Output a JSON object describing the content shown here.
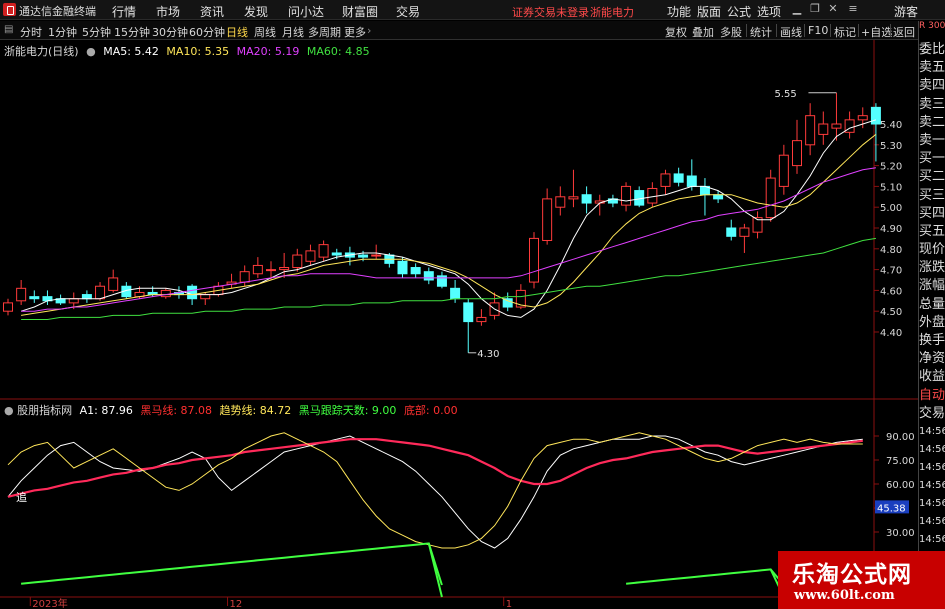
{
  "titlebar": {
    "app_name": "通达信金融终端",
    "menu": [
      "行情",
      "市场",
      "资讯",
      "发现",
      "问小达",
      "财富圈",
      "交易"
    ],
    "warning": "证券交易未登录",
    "stock_name": "浙能电力",
    "right_menu": [
      "功能",
      "版面",
      "公式",
      "选项"
    ],
    "guest": "游客"
  },
  "toolbar": {
    "left": "主图",
    "periods": [
      "分时",
      "1分钟",
      "5分钟",
      "15分钟",
      "30分钟",
      "60分钟",
      "日线",
      "周线",
      "月线",
      "多周期",
      "更多"
    ],
    "active_period": "日线",
    "right": [
      "复权",
      "叠加",
      "多股",
      "统计",
      "画线",
      "F10",
      "标记",
      "+自选",
      "返回"
    ]
  },
  "main_legend": {
    "title": "浙能电力(日线)",
    "ma": [
      {
        "label": "MA5: 5.42",
        "color": "#ffffff"
      },
      {
        "label": "MA10: 5.35",
        "color": "#ffe65a"
      },
      {
        "label": "MA20: 5.19",
        "color": "#e040ff"
      },
      {
        "label": "MA60: 4.85",
        "color": "#40e040"
      }
    ]
  },
  "sub_legend": {
    "title": "股朋指标网",
    "items": [
      {
        "label": "A1: 87.96",
        "color": "#ffffff"
      },
      {
        "label": "黑马线: 87.08",
        "color": "#ff3030"
      },
      {
        "label": "趋势线: 84.72",
        "color": "#ffe65a"
      },
      {
        "label": "黑马跟踪天数: 9.00",
        "color": "#40ff40"
      },
      {
        "label": "底部: 0.00",
        "color": "#ff3030"
      }
    ],
    "signal": "追"
  },
  "price_axis": [
    "5.40",
    "5.30",
    "5.20",
    "5.10",
    "5.00",
    "4.90",
    "4.80",
    "4.70",
    "4.60",
    "4.50",
    "4.40"
  ],
  "sub_axis": [
    "90.00",
    "75.00",
    "60.00",
    "45.38",
    "30.00"
  ],
  "highlight_value": "45.38",
  "annotations": {
    "high": "5.55",
    "low": "4.30"
  },
  "date_axis": [
    "2023年",
    "12",
    "1"
  ],
  "side_panel": {
    "top_small": "R 300",
    "items": [
      "委比",
      "卖五",
      "卖四",
      "卖三",
      "卖二",
      "卖一",
      "买一",
      "买二",
      "买三",
      "买四",
      "买五",
      "现价",
      "涨跌",
      "涨幅",
      "总量",
      "外盘",
      "换手",
      "净资",
      "收益"
    ],
    "lower": [
      "自动",
      "交易"
    ],
    "times": [
      "14:56",
      "14:56",
      "14:56",
      "14:56",
      "14:56",
      "14:56",
      "14:56",
      "14:56",
      "14:56"
    ]
  },
  "watermark": {
    "cn": "乐淘公式网",
    "en": "www.60lt.com"
  },
  "colors": {
    "up": "#ff3b3b",
    "down": "#54ffff",
    "ma5": "#ffffff",
    "ma10": "#ffe65a",
    "ma20": "#e040ff",
    "ma60": "#40e040",
    "heima": "#ff2a5a",
    "trend": "#ffe65a",
    "track": "#40ff40"
  },
  "chart_data": [
    {
      "type": "candlestick",
      "title": "浙能电力(日线)",
      "ylim": [
        4.3,
        5.6
      ],
      "y_ticks": [
        4.4,
        4.5,
        4.6,
        4.7,
        4.8,
        4.9,
        5.0,
        5.1,
        5.2,
        5.3,
        5.4
      ],
      "candles": [
        {
          "o": 4.5,
          "h": 4.56,
          "l": 4.48,
          "c": 4.54
        },
        {
          "o": 4.55,
          "h": 4.65,
          "l": 4.53,
          "c": 4.61
        },
        {
          "o": 4.57,
          "h": 4.6,
          "l": 4.54,
          "c": 4.56
        },
        {
          "o": 4.57,
          "h": 4.6,
          "l": 4.53,
          "c": 4.55
        },
        {
          "o": 4.56,
          "h": 4.58,
          "l": 4.53,
          "c": 4.54
        },
        {
          "o": 4.54,
          "h": 4.59,
          "l": 4.51,
          "c": 4.56
        },
        {
          "o": 4.58,
          "h": 4.6,
          "l": 4.54,
          "c": 4.56
        },
        {
          "o": 4.56,
          "h": 4.64,
          "l": 4.55,
          "c": 4.62
        },
        {
          "o": 4.6,
          "h": 4.7,
          "l": 4.59,
          "c": 4.66
        },
        {
          "o": 4.62,
          "h": 4.64,
          "l": 4.56,
          "c": 4.57
        },
        {
          "o": 4.57,
          "h": 4.62,
          "l": 4.56,
          "c": 4.59
        },
        {
          "o": 4.59,
          "h": 4.62,
          "l": 4.57,
          "c": 4.58
        },
        {
          "o": 4.57,
          "h": 4.61,
          "l": 4.56,
          "c": 4.6
        },
        {
          "o": 4.59,
          "h": 4.62,
          "l": 4.56,
          "c": 4.58
        },
        {
          "o": 4.62,
          "h": 4.63,
          "l": 4.53,
          "c": 4.56
        },
        {
          "o": 4.56,
          "h": 4.59,
          "l": 4.53,
          "c": 4.58
        },
        {
          "o": 4.58,
          "h": 4.64,
          "l": 4.57,
          "c": 4.62
        },
        {
          "o": 4.63,
          "h": 4.68,
          "l": 4.61,
          "c": 4.64
        },
        {
          "o": 4.64,
          "h": 4.72,
          "l": 4.62,
          "c": 4.69
        },
        {
          "o": 4.68,
          "h": 4.76,
          "l": 4.66,
          "c": 4.72
        },
        {
          "o": 4.7,
          "h": 4.74,
          "l": 4.65,
          "c": 4.7
        },
        {
          "o": 4.7,
          "h": 4.78,
          "l": 4.66,
          "c": 4.71
        },
        {
          "o": 4.71,
          "h": 4.8,
          "l": 4.69,
          "c": 4.77
        },
        {
          "o": 4.74,
          "h": 4.82,
          "l": 4.72,
          "c": 4.79
        },
        {
          "o": 4.76,
          "h": 4.84,
          "l": 4.74,
          "c": 4.82
        },
        {
          "o": 4.78,
          "h": 4.8,
          "l": 4.75,
          "c": 4.77
        },
        {
          "o": 4.78,
          "h": 4.81,
          "l": 4.72,
          "c": 4.76
        },
        {
          "o": 4.77,
          "h": 4.79,
          "l": 4.74,
          "c": 4.76
        },
        {
          "o": 4.77,
          "h": 4.82,
          "l": 4.75,
          "c": 4.77
        },
        {
          "o": 4.77,
          "h": 4.78,
          "l": 4.71,
          "c": 4.73
        },
        {
          "o": 4.74,
          "h": 4.76,
          "l": 4.66,
          "c": 4.68
        },
        {
          "o": 4.71,
          "h": 4.73,
          "l": 4.66,
          "c": 4.68
        },
        {
          "o": 4.69,
          "h": 4.71,
          "l": 4.63,
          "c": 4.65
        },
        {
          "o": 4.67,
          "h": 4.69,
          "l": 4.61,
          "c": 4.62
        },
        {
          "o": 4.61,
          "h": 4.65,
          "l": 4.54,
          "c": 4.56
        },
        {
          "o": 4.54,
          "h": 4.56,
          "l": 4.3,
          "c": 4.45
        },
        {
          "o": 4.45,
          "h": 4.51,
          "l": 4.43,
          "c": 4.47
        },
        {
          "o": 4.48,
          "h": 4.59,
          "l": 4.46,
          "c": 4.54
        },
        {
          "o": 4.56,
          "h": 4.59,
          "l": 4.5,
          "c": 4.52
        },
        {
          "o": 4.52,
          "h": 4.63,
          "l": 4.51,
          "c": 4.6
        },
        {
          "o": 4.64,
          "h": 4.88,
          "l": 4.61,
          "c": 4.85
        },
        {
          "o": 4.84,
          "h": 5.09,
          "l": 4.82,
          "c": 5.04
        },
        {
          "o": 5.0,
          "h": 5.1,
          "l": 4.96,
          "c": 5.05
        },
        {
          "o": 5.04,
          "h": 5.18,
          "l": 5.0,
          "c": 5.05
        },
        {
          "o": 5.06,
          "h": 5.1,
          "l": 4.97,
          "c": 5.02
        },
        {
          "o": 5.02,
          "h": 5.06,
          "l": 4.96,
          "c": 5.03
        },
        {
          "o": 5.04,
          "h": 5.06,
          "l": 5.0,
          "c": 5.02
        },
        {
          "o": 5.01,
          "h": 5.12,
          "l": 4.98,
          "c": 5.1
        },
        {
          "o": 5.08,
          "h": 5.1,
          "l": 5.0,
          "c": 5.01
        },
        {
          "o": 5.02,
          "h": 5.12,
          "l": 5.0,
          "c": 5.09
        },
        {
          "o": 5.1,
          "h": 5.18,
          "l": 5.06,
          "c": 5.16
        },
        {
          "o": 5.16,
          "h": 5.19,
          "l": 5.1,
          "c": 5.12
        },
        {
          "o": 5.15,
          "h": 5.23,
          "l": 5.08,
          "c": 5.1
        },
        {
          "o": 5.1,
          "h": 5.14,
          "l": 4.96,
          "c": 5.06
        },
        {
          "o": 5.06,
          "h": 5.08,
          "l": 5.02,
          "c": 5.04
        },
        {
          "o": 4.9,
          "h": 4.94,
          "l": 4.84,
          "c": 4.86
        },
        {
          "o": 4.86,
          "h": 4.92,
          "l": 4.78,
          "c": 4.9
        },
        {
          "o": 4.88,
          "h": 4.98,
          "l": 4.85,
          "c": 4.95
        },
        {
          "o": 4.95,
          "h": 5.18,
          "l": 4.93,
          "c": 5.14
        },
        {
          "o": 5.1,
          "h": 5.3,
          "l": 5.06,
          "c": 5.25
        },
        {
          "o": 5.2,
          "h": 5.42,
          "l": 5.16,
          "c": 5.32
        },
        {
          "o": 5.3,
          "h": 5.5,
          "l": 5.25,
          "c": 5.44
        },
        {
          "o": 5.35,
          "h": 5.46,
          "l": 5.3,
          "c": 5.4
        },
        {
          "o": 5.38,
          "h": 5.55,
          "l": 5.32,
          "c": 5.4
        },
        {
          "o": 5.36,
          "h": 5.46,
          "l": 5.33,
          "c": 5.42
        },
        {
          "o": 5.42,
          "h": 5.48,
          "l": 5.38,
          "c": 5.44
        },
        {
          "o": 5.48,
          "h": 5.5,
          "l": 5.22,
          "c": 5.4
        }
      ],
      "ma_series": [
        {
          "name": "MA5",
          "values": [
            4.5,
            4.52,
            4.55,
            4.56,
            4.56,
            4.56,
            4.56,
            4.58,
            4.6,
            4.61,
            4.61,
            4.61,
            4.6,
            4.58,
            4.58,
            4.58,
            4.59,
            4.61,
            4.63,
            4.66,
            4.69,
            4.7,
            4.72,
            4.74,
            4.76,
            4.77,
            4.78,
            4.78,
            4.77,
            4.76,
            4.74,
            4.72,
            4.7,
            4.68,
            4.63,
            4.56,
            4.51,
            4.48,
            4.47,
            4.51,
            4.6,
            4.72,
            4.85,
            4.96,
            5.02,
            5.04,
            5.03,
            5.04,
            5.05,
            5.06,
            5.08,
            5.1,
            5.1,
            5.08,
            5.04,
            4.98,
            4.94,
            4.94,
            4.98,
            5.06,
            5.15,
            5.26,
            5.34,
            5.38,
            5.4,
            5.42
          ]
        },
        {
          "name": "MA10",
          "values": [
            4.48,
            4.49,
            4.5,
            4.51,
            4.52,
            4.53,
            4.54,
            4.55,
            4.56,
            4.57,
            4.58,
            4.58,
            4.58,
            4.58,
            4.59,
            4.6,
            4.61,
            4.62,
            4.63,
            4.65,
            4.67,
            4.68,
            4.7,
            4.72,
            4.73,
            4.74,
            4.75,
            4.75,
            4.75,
            4.75,
            4.74,
            4.73,
            4.71,
            4.69,
            4.66,
            4.62,
            4.58,
            4.55,
            4.53,
            4.52,
            4.54,
            4.58,
            4.64,
            4.71,
            4.78,
            4.86,
            4.92,
            4.97,
            5.0,
            5.02,
            5.04,
            5.05,
            5.06,
            5.06,
            5.06,
            5.04,
            5.02,
            5.01,
            5.0,
            5.02,
            5.06,
            5.12,
            5.18,
            5.24,
            5.3,
            5.35
          ]
        },
        {
          "name": "MA20",
          "values": [
            4.5,
            4.5,
            4.51,
            4.51,
            4.52,
            4.52,
            4.53,
            4.54,
            4.55,
            4.56,
            4.57,
            4.58,
            4.59,
            4.6,
            4.61,
            4.62,
            4.63,
            4.64,
            4.65,
            4.66,
            4.67,
            4.67,
            4.68,
            4.68,
            4.68,
            4.68,
            4.67,
            4.66,
            4.66,
            4.66,
            4.66,
            4.66,
            4.66,
            4.66,
            4.66,
            4.66,
            4.66,
            4.66,
            4.67,
            4.69,
            4.71,
            4.73,
            4.75,
            4.77,
            4.79,
            4.81,
            4.83,
            4.85,
            4.87,
            4.89,
            4.91,
            4.93,
            4.94,
            4.96,
            4.97,
            4.98,
            4.99,
            5.01,
            5.03,
            5.06,
            5.09,
            5.12,
            5.14,
            5.16,
            5.18,
            5.19
          ]
        },
        {
          "name": "MA60",
          "values": [
            4.46,
            4.46,
            4.46,
            4.47,
            4.47,
            4.47,
            4.47,
            4.48,
            4.48,
            4.48,
            4.49,
            4.49,
            4.49,
            4.49,
            4.5,
            4.5,
            4.5,
            4.51,
            4.51,
            4.51,
            4.52,
            4.52,
            4.52,
            4.53,
            4.53,
            4.53,
            4.54,
            4.54,
            4.54,
            4.55,
            4.55,
            4.55,
            4.55,
            4.56,
            4.56,
            4.56,
            4.56,
            4.57,
            4.57,
            4.58,
            4.59,
            4.6,
            4.61,
            4.62,
            4.62,
            4.63,
            4.64,
            4.65,
            4.66,
            4.67,
            4.67,
            4.68,
            4.69,
            4.7,
            4.71,
            4.72,
            4.73,
            4.74,
            4.75,
            4.76,
            4.77,
            4.78,
            4.8,
            4.82,
            4.84,
            4.85
          ]
        }
      ]
    },
    {
      "type": "line",
      "title": "股朋指标网",
      "ylim": [
        15,
        100
      ],
      "y_ticks": [
        30,
        45,
        60,
        75,
        90
      ],
      "series": [
        {
          "name": "A1",
          "values": [
            52,
            62,
            70,
            78,
            84,
            86,
            80,
            74,
            70,
            69,
            68,
            70,
            73,
            76,
            80,
            76,
            64,
            56,
            62,
            68,
            74,
            80,
            82,
            84,
            86,
            88,
            90,
            86,
            82,
            78,
            74,
            68,
            60,
            52,
            42,
            32,
            24,
            20,
            26,
            38,
            52,
            68,
            78,
            82,
            84,
            86,
            88,
            88,
            88,
            90,
            90,
            88,
            84,
            80,
            78,
            74,
            72,
            74,
            76,
            78,
            80,
            82,
            84,
            86,
            87,
            88
          ]
        },
        {
          "name": "黑马线",
          "values": [
            52,
            54,
            56,
            57,
            59,
            61,
            62,
            64,
            66,
            67,
            69,
            70,
            72,
            73,
            75,
            76,
            77,
            78,
            80,
            81,
            82,
            83,
            84,
            85,
            86,
            87,
            88,
            88,
            88,
            87,
            86,
            85,
            84,
            82,
            80,
            78,
            74,
            70,
            65,
            62,
            60,
            60,
            62,
            66,
            70,
            73,
            75,
            76,
            78,
            80,
            81,
            82,
            83,
            84,
            84,
            82,
            80,
            79,
            80,
            81,
            82,
            83,
            84,
            85,
            86,
            87
          ]
        },
        {
          "name": "趋势线",
          "values": [
            72,
            80,
            84,
            86,
            78,
            70,
            74,
            78,
            82,
            76,
            70,
            64,
            58,
            56,
            60,
            66,
            72,
            76,
            82,
            86,
            90,
            92,
            88,
            84,
            80,
            74,
            62,
            50,
            40,
            32,
            28,
            24,
            22,
            20,
            20,
            22,
            26,
            34,
            46,
            62,
            76,
            84,
            86,
            88,
            88,
            86,
            88,
            90,
            92,
            90,
            88,
            84,
            80,
            76,
            74,
            76,
            80,
            84,
            86,
            88,
            86,
            88,
            86,
            85,
            85,
            85
          ]
        },
        {
          "name": "黑马跟踪天数",
          "values": [
            0,
            1,
            2,
            3,
            4,
            5,
            6,
            7,
            8,
            9,
            10,
            11,
            12,
            13,
            14,
            15,
            16,
            17,
            18,
            19,
            20,
            21,
            22,
            23,
            24,
            25,
            26,
            27,
            28,
            29,
            30,
            31,
            32,
            0,
            0,
            0,
            0,
            0,
            0,
            0,
            0,
            0,
            0,
            0,
            0,
            0,
            0,
            1,
            2,
            3,
            4,
            5,
            6,
            7,
            8,
            9,
            10,
            11,
            12,
            0,
            0,
            0,
            0,
            0,
            0,
            9
          ]
        }
      ]
    }
  ]
}
